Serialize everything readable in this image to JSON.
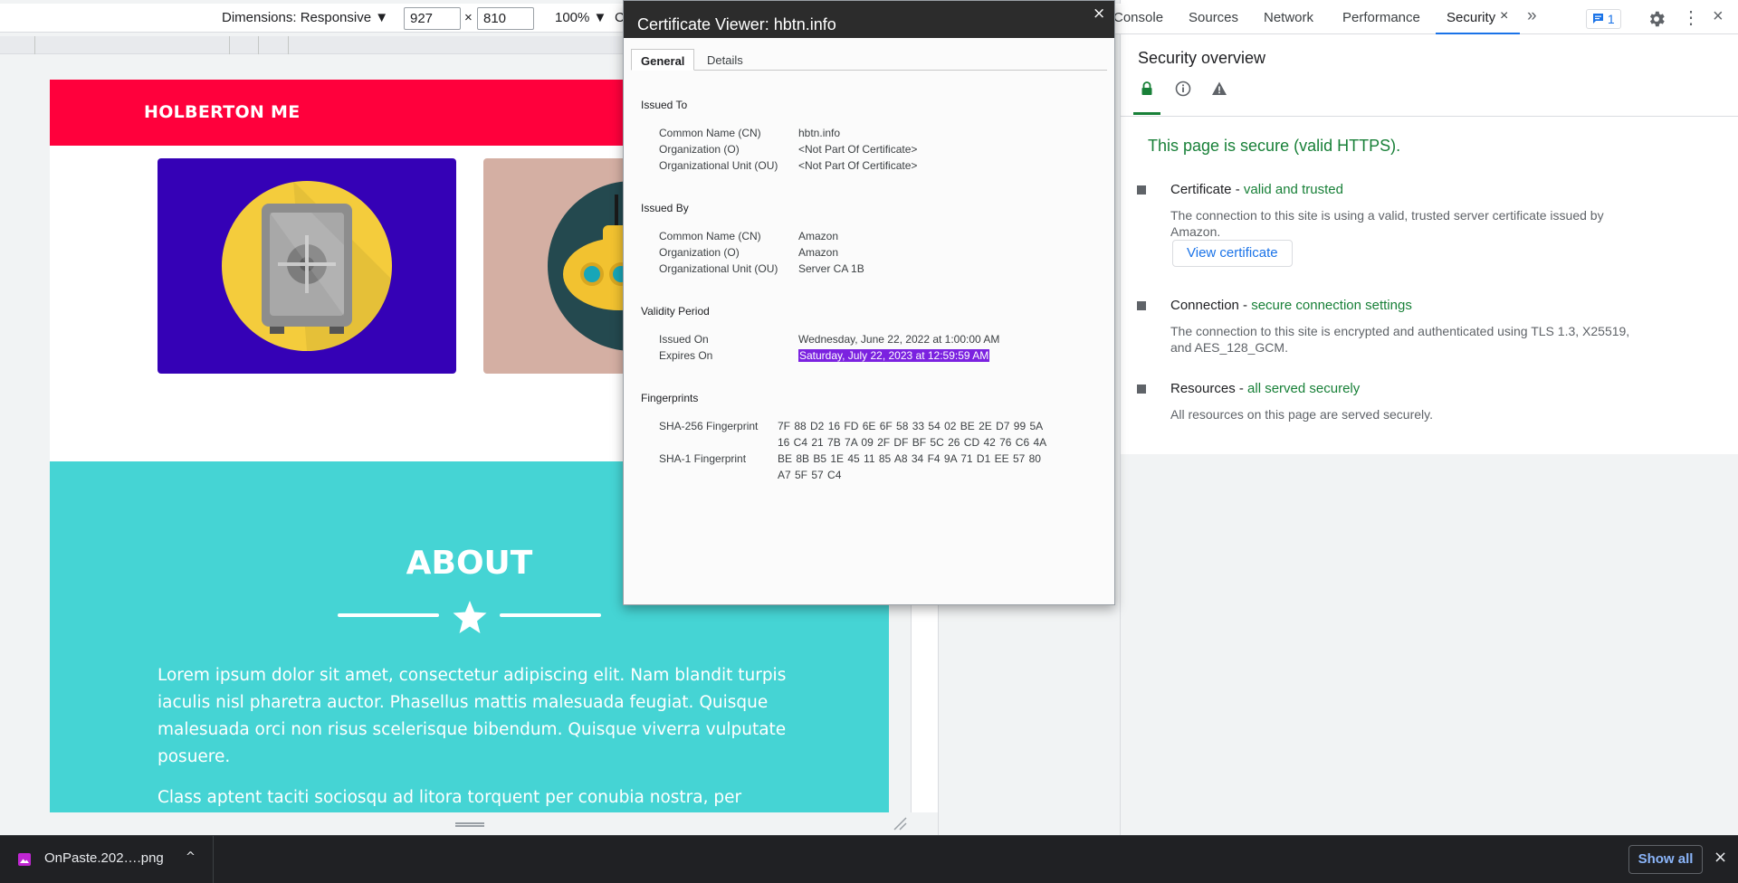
{
  "device_toolbar": {
    "dimensions_label": "Dimensions: Responsive ▼",
    "width": "927",
    "times": "×",
    "height": "810",
    "zoom": "100% ▼",
    "extra": "C"
  },
  "site": {
    "logo": "HOLBERTON ME",
    "about_title": "ABOUT",
    "about_p1": "Lorem ipsum dolor sit amet, consectetur adipiscing elit. Nam blandit turpis iaculis nisl pharetra auctor. Phasellus mattis malesuada feugiat. Quisque malesuada orci non risus scelerisque bibendum. Quisque viverra vulputate posuere.",
    "about_p2": "Class aptent taciti sociosqu ad litora torquent per conubia nostra, per inceptos",
    "colors": {
      "header": "#ff003c",
      "about_bg": "#45d4d4",
      "card_safe": "#3501b6",
      "card_sub": "#d4afa3"
    }
  },
  "devtools": {
    "tabs": {
      "console": "Console",
      "sources": "Sources",
      "network": "Network",
      "performance": "Performance",
      "security": "Security"
    },
    "close_symbol": "×",
    "more_symbol": "»",
    "issues_count": "1",
    "kebab_symbol": "⋮"
  },
  "security": {
    "title": "Security overview",
    "summary": "This page is secure (valid HTTPS).",
    "certificate": {
      "label": "Certificate - ",
      "status": "valid and trusted",
      "desc": "The connection to this site is using a valid, trusted server certificate issued by Amazon.",
      "button": "View certificate"
    },
    "connection": {
      "label": "Connection - ",
      "status": "secure connection settings",
      "desc": "The connection to this site is encrypted and authenticated using TLS 1.3, X25519, and AES_128_GCM."
    },
    "resources": {
      "label": "Resources - ",
      "status": "all served securely",
      "desc": "All resources on this page are served securely."
    }
  },
  "cert_viewer": {
    "title": "Certificate Viewer: hbtn.info",
    "close": "×",
    "tab_general": "General",
    "tab_details": "Details",
    "issued_to": {
      "heading": "Issued To",
      "cn_label": "Common Name (CN)",
      "cn": "hbtn.info",
      "o_label": "Organization (O)",
      "o": "<Not Part Of Certificate>",
      "ou_label": "Organizational Unit (OU)",
      "ou": "<Not Part Of Certificate>"
    },
    "issued_by": {
      "heading": "Issued By",
      "cn_label": "Common Name (CN)",
      "cn": "Amazon",
      "o_label": "Organization (O)",
      "o": "Amazon",
      "ou_label": "Organizational Unit (OU)",
      "ou": "Server CA 1B"
    },
    "validity": {
      "heading": "Validity Period",
      "issued_label": "Issued On",
      "issued": "Wednesday, June 22, 2022 at 1:00:00 AM",
      "expires_label": "Expires On",
      "expires": "Saturday, July 22, 2023 at 12:59:59 AM"
    },
    "fingerprints": {
      "heading": "Fingerprints",
      "sha256_label": "SHA-256 Fingerprint",
      "sha256": "7F 88 D2 16 FD 6E 6F 58 33 54 02 BE 2E D7 99 5A 16 C4 21 7B 7A 09 2F DF BF 5C 26 CD 42 76 C6 4A",
      "sha1_label": "SHA-1 Fingerprint",
      "sha1": "BE 8B B5 1E 45 11 85 A8 34 F4 9A 71 D1 EE 57 80 A7 5F 57 C4"
    }
  },
  "download_bar": {
    "file_name": "OnPaste.202….png",
    "chevron": "^",
    "show_all": "Show all",
    "close": "×"
  }
}
